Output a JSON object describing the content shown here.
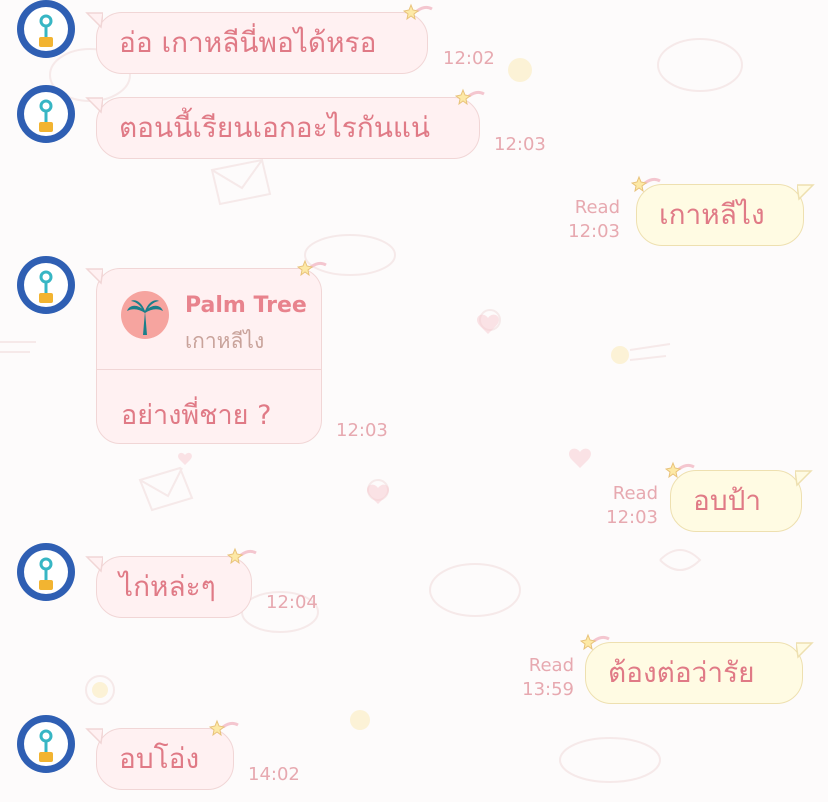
{
  "messages": [
    {
      "side": "in",
      "text": "อ่อ เกาหลีนี่พอได้หรอ",
      "time": "12:02"
    },
    {
      "side": "in",
      "text": "ตอนนี้เรียนเอกอะไรกันแน่",
      "time": "12:03"
    },
    {
      "side": "out",
      "text": "เกาหลีไง",
      "read": "Read",
      "time": "12:03"
    },
    {
      "side": "in",
      "reply_to": {
        "name": "Palm Tree",
        "quote": "เกาหลีไง"
      },
      "text": "อย่างพี่ชาย ?",
      "time": "12:03"
    },
    {
      "side": "out",
      "text": "อบป้า",
      "read": "Read",
      "time": "12:03"
    },
    {
      "side": "in",
      "text": "ไก่หล่ะๆ",
      "time": "12:04"
    },
    {
      "side": "out",
      "text": "ต้องต่อว่ารัย",
      "read": "Read",
      "time": "13:59"
    },
    {
      "side": "in",
      "text": "อบโอ่ง",
      "time": "14:02"
    }
  ],
  "icons": {
    "avatar": "lightbulb-avatar-icon",
    "reply_avatar": "palm-tree-icon",
    "bubble_deco": "shooting-star-icon",
    "background": "pastel-doodle-pattern"
  },
  "colors": {
    "background": "#fdfbfb",
    "in_bubble": "#fff1f2",
    "out_bubble": "#fffbe3",
    "text": "#e07a86",
    "meta": "#e7a9b0",
    "avatar": "#2f5fb3",
    "palm_avatar": "#f6a49f"
  }
}
